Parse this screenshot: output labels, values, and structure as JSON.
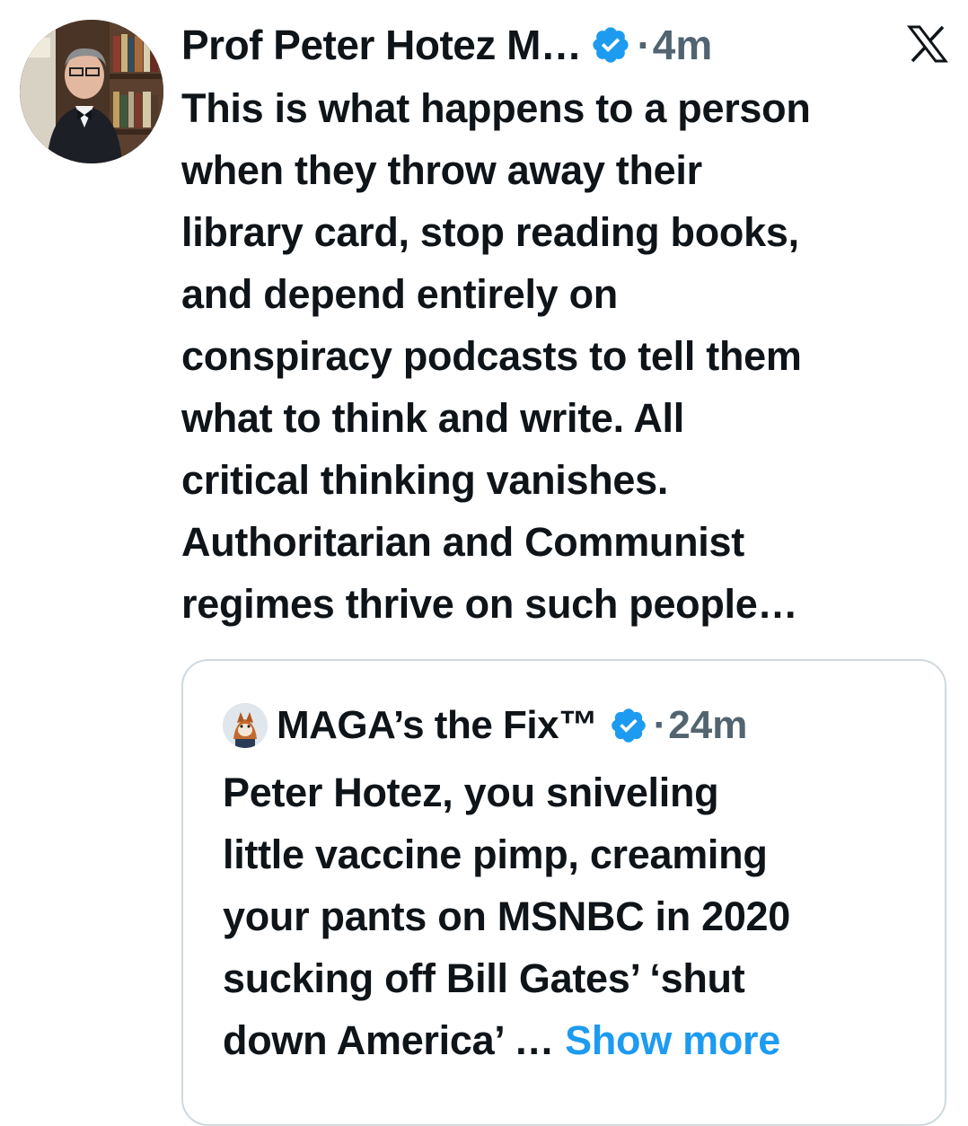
{
  "tweet": {
    "author_name": "Prof Peter Hotez M…",
    "separator": "·",
    "time": "4m",
    "text": "This is what happens to a person\nwhen they throw away their\nlibrary card, stop reading books,\nand depend entirely on\nconspiracy podcasts to tell them\nwhat to think and write. All\ncritical thinking vanishes.\nAuthoritarian and Communist\nregimes thrive on such people…"
  },
  "quoted_tweet": {
    "author_name": "MAGA’s the Fix™",
    "separator": "·",
    "time": "24m",
    "text": "Peter Hotez, you sniveling\nlittle vaccine pimp, creaming\nyour pants on MSNBC in 2020\nsucking off Bill Gates’ ‘shut\ndown America’ ",
    "ellipsis": "…",
    "show_more": "Show more"
  },
  "icons": {
    "verified_badge": "verified-badge-icon",
    "platform_logo": "x-logo-icon"
  },
  "colors": {
    "text": "#0f1419",
    "secondary": "#536471",
    "link": "#1d9bf0",
    "border": "#cfd9de",
    "verified": "#1d9bf0"
  }
}
